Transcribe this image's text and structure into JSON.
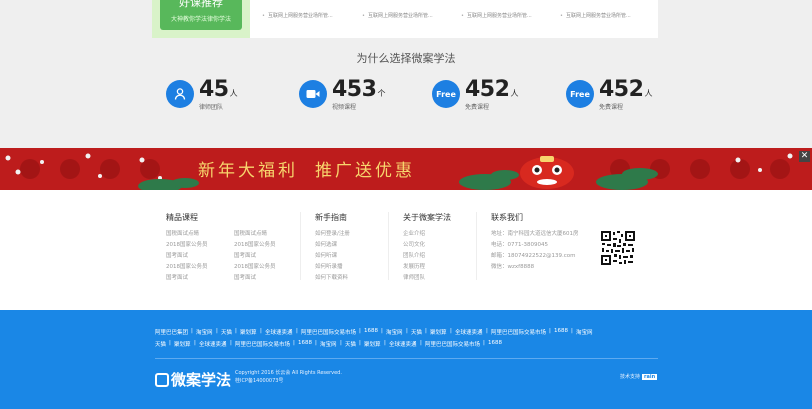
{
  "promo": {
    "title": "好课推荐",
    "subtitle": "大神教你学法律你学法"
  },
  "news": [
    "互联网上网服务营业场所管...",
    "互联网上网服务营业场所管...",
    "互联网上网服务营业场所管...",
    "互联网上网服务营业场所管..."
  ],
  "why": {
    "title": "为什么选择微案学法",
    "stats": [
      {
        "icon": "people-icon",
        "icon_text": "",
        "num": "45",
        "unit": "人",
        "label": "律师团队"
      },
      {
        "icon": "video-icon",
        "icon_text": "",
        "num": "453",
        "unit": "个",
        "label": "视频课程"
      },
      {
        "icon": "free-icon",
        "icon_text": "Free",
        "num": "452",
        "unit": "人",
        "label": "免费课程"
      },
      {
        "icon": "free-icon",
        "icon_text": "Free",
        "num": "452",
        "unit": "人",
        "label": "免费课程"
      }
    ]
  },
  "banner": {
    "slogan1": "新年大福利",
    "slogan2": "推广送优惠",
    "close": "✕"
  },
  "footer": {
    "col1": {
      "title": "精品课程",
      "left": [
        "国税面试点睛",
        "2018国家公务员",
        "国考面试",
        "2018国家公务员",
        "国考面试"
      ],
      "right": [
        "国税面试点睛",
        "2018国家公务员",
        "国考面试",
        "2018国家公务员",
        "国考面试"
      ]
    },
    "col2": {
      "title": "新手指南",
      "items": [
        "如何登录/注册",
        "如何选课",
        "如何听课",
        "如何听录播",
        "如何下载资料"
      ]
    },
    "col3": {
      "title": "关于微案学法",
      "items": [
        "企业介绍",
        "公司文化",
        "团队介绍",
        "发展历程",
        "律师团队"
      ]
    },
    "col4": {
      "title": "联系我们",
      "items": [
        "地址：南宁科园大道远信大厦601房",
        "电话：0771-3809045",
        "邮箱：18074922522@139.com",
        "微信：wzxf8888"
      ]
    }
  },
  "friend_links": {
    "row1": [
      "阿里巴巴集团",
      "淘宝网",
      "天猫",
      "聚划算",
      "全球速卖通",
      "阿里巴巴国际交易市场",
      "1688",
      "淘宝网",
      "天猫",
      "聚划算",
      "全球速卖通",
      "阿里巴巴国际交易市场",
      "1688",
      "淘宝网"
    ],
    "row2": [
      "天猫",
      "聚划算",
      "全球速卖通",
      "阿里巴巴国际交易市场",
      "1688",
      "淘宝网",
      "天猫",
      "聚划算",
      "全球速卖通",
      "阿里巴巴国际交易市场",
      "1688"
    ]
  },
  "bottom": {
    "logo": "微案学法",
    "copyright": "Copyright 2016 长云会 All Rights Reserved.",
    "icp": "桂ICP备14000073号",
    "tech_label": "技术支持",
    "tech_badge": "rain"
  },
  "colors": {
    "blue": "#1a87e6",
    "banner_red": "#bd1c1c",
    "green": "#58b85b"
  }
}
